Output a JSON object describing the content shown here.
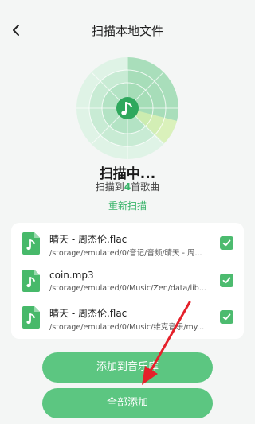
{
  "header": {
    "title": "扫描本地文件",
    "back_icon": "chevron-left-icon"
  },
  "scan": {
    "center_icon": "music-note-icon",
    "status": "扫描中...",
    "found_prefix": "扫描到",
    "found_count": "4",
    "found_suffix": "首歌曲",
    "rescan_label": "重新扫描"
  },
  "files": [
    {
      "name": "晴天 - 周杰伦.flac",
      "path": "/storage/emulated/0/音记/音频/晴天 - 周...",
      "checked": true
    },
    {
      "name": "coin.mp3",
      "path": "/storage/emulated/0/Music/Zen/data/lib...",
      "checked": true
    },
    {
      "name": "晴天 - 周杰伦.flac",
      "path": "/storage/emulated/0/Music/维克音乐/my...",
      "checked": true
    }
  ],
  "actions": {
    "add_to_library": "添加到音乐库",
    "add_all": "全部添加"
  },
  "colors": {
    "accent": "#39b46a",
    "button": "#5cc681",
    "annotation_arrow": "#e5202a"
  }
}
